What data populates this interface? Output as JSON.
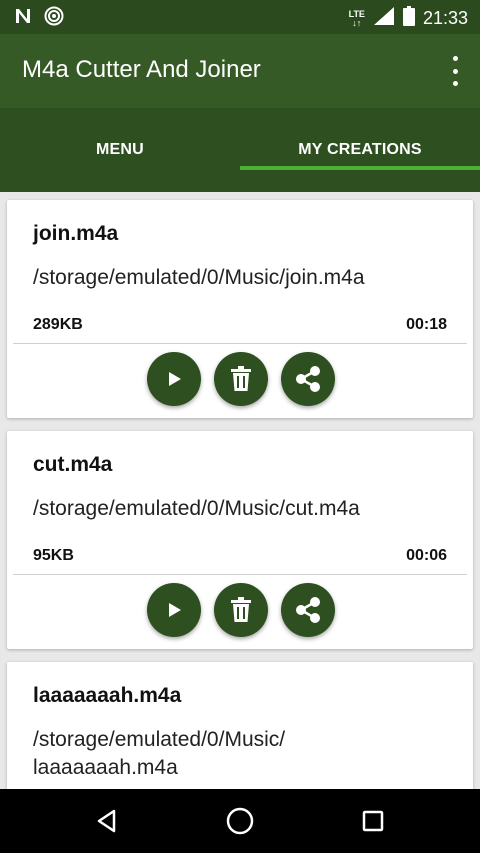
{
  "status_bar": {
    "time": "21:33",
    "network": "LTE"
  },
  "app_bar": {
    "title": "M4a Cutter And Joiner"
  },
  "tabs": [
    {
      "label": "MENU"
    },
    {
      "label": "MY CREATIONS"
    }
  ],
  "creations": [
    {
      "name": "join.m4a",
      "path": "/storage/emulated/0/Music/join.m4a",
      "size": "289KB",
      "duration": "00:18"
    },
    {
      "name": "cut.m4a",
      "path": "/storage/emulated/0/Music/cut.m4a",
      "size": "95KB",
      "duration": "00:06"
    },
    {
      "name": "laaaaaaah.m4a",
      "path": "/storage/emulated/0/Music/\nlaaaaaaah.m4a"
    }
  ],
  "colors": {
    "app_bar": "#355a26",
    "tab_bar": "#2e5020",
    "indicator": "#4caf35",
    "fab": "#2e4f20"
  }
}
